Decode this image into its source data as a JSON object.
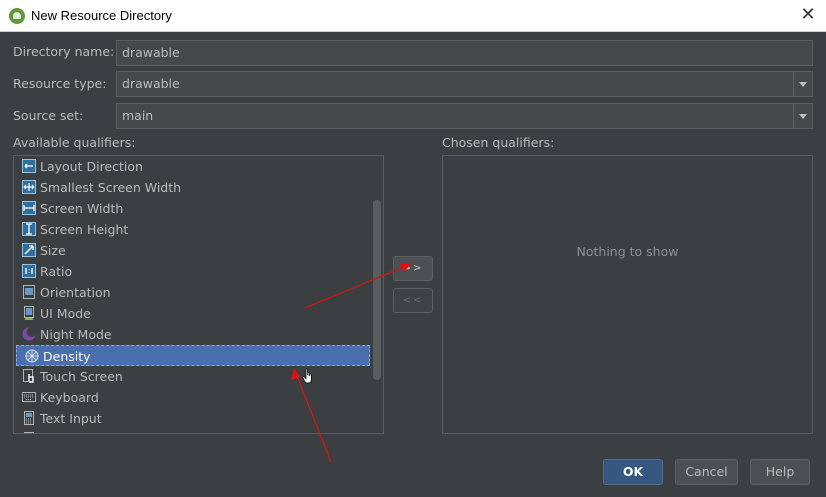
{
  "window": {
    "title": "New Resource Directory"
  },
  "form": {
    "directory_name": {
      "label": "Directory name:",
      "value": "drawable"
    },
    "resource_type": {
      "label": "Resource type:",
      "value": "drawable"
    },
    "source_set": {
      "label": "Source set:",
      "value": "main"
    }
  },
  "available": {
    "label": "Available qualifiers:",
    "items": [
      {
        "label": "Layout Direction",
        "icon": "layout-direction-icon"
      },
      {
        "label": "Smallest Screen Width",
        "icon": "smallest-width-icon"
      },
      {
        "label": "Screen Width",
        "icon": "screen-width-icon"
      },
      {
        "label": "Screen Height",
        "icon": "screen-height-icon"
      },
      {
        "label": "Size",
        "icon": "size-icon"
      },
      {
        "label": "Ratio",
        "icon": "ratio-icon"
      },
      {
        "label": "Orientation",
        "icon": "orientation-icon"
      },
      {
        "label": "UI Mode",
        "icon": "ui-mode-icon"
      },
      {
        "label": "Night Mode",
        "icon": "night-mode-icon"
      },
      {
        "label": "Density",
        "icon": "density-icon",
        "selected": true
      },
      {
        "label": "Touch Screen",
        "icon": "touch-screen-icon"
      },
      {
        "label": "Keyboard",
        "icon": "keyboard-icon"
      },
      {
        "label": "Text Input",
        "icon": "text-input-icon"
      }
    ]
  },
  "transfer": {
    "add_label": ">>",
    "remove_label": "<<"
  },
  "chosen": {
    "label": "Chosen qualifiers:",
    "empty_text": "Nothing to show"
  },
  "buttons": {
    "ok": "OK",
    "cancel": "Cancel",
    "help": "Help"
  },
  "colors": {
    "background": "#3c3f41",
    "selection": "#4b6eaf",
    "annotation_arrow": "#e01010"
  }
}
